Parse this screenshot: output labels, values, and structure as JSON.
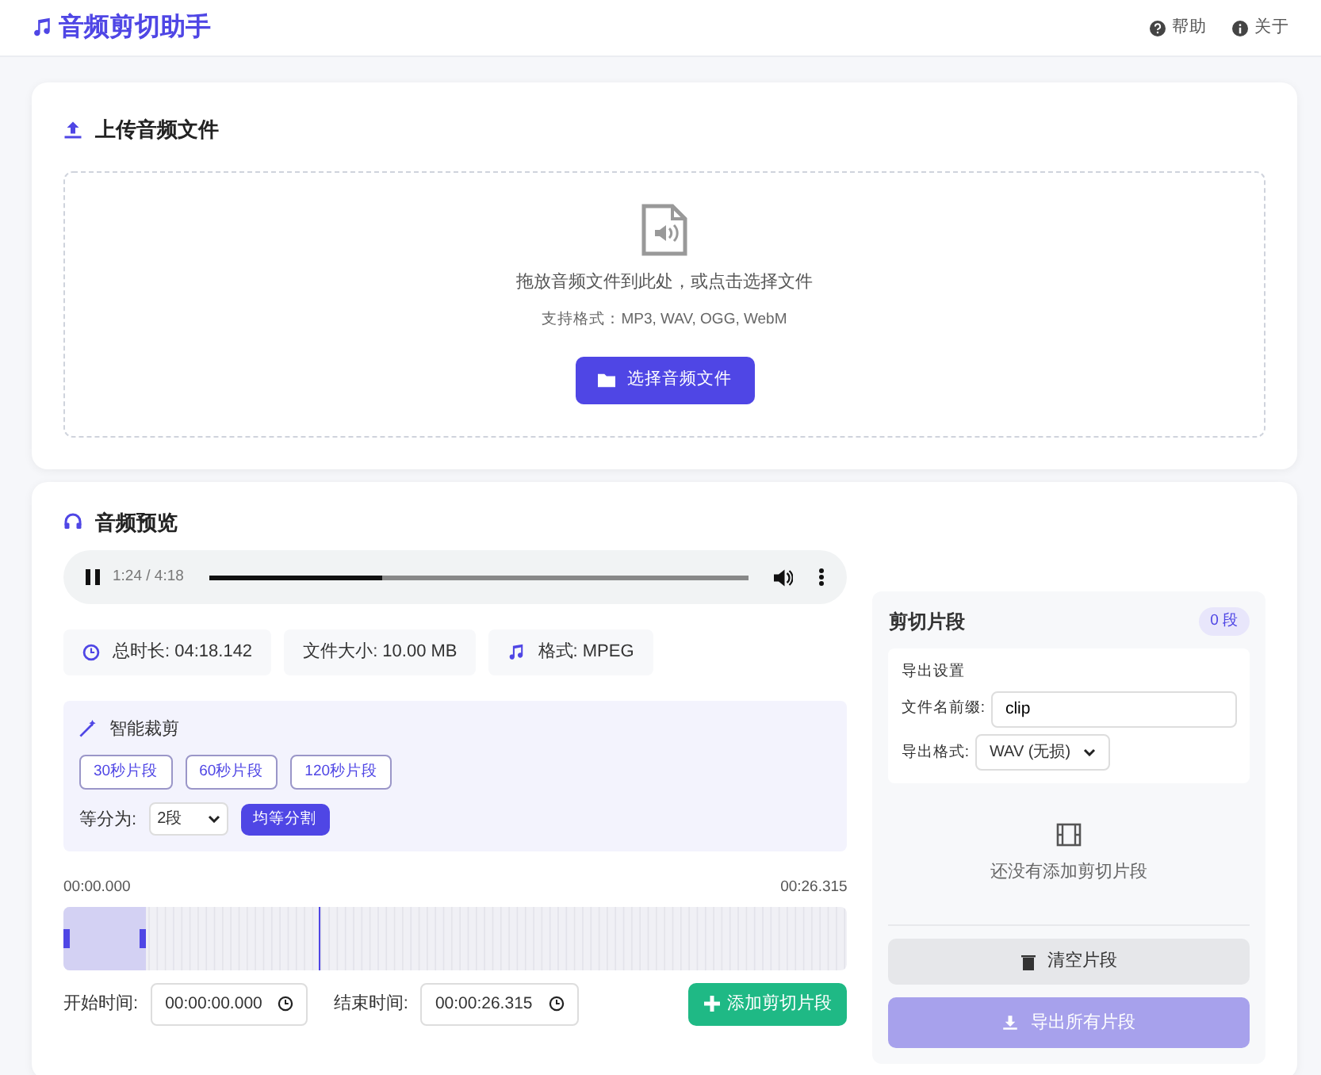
{
  "header": {
    "title": "音频剪切助手",
    "links": [
      "帮助",
      "关于"
    ]
  },
  "upload": {
    "title": "上传音频文件",
    "hint": "拖放音频文件到此处，或点击选择文件",
    "formats": "支持格式：MP3, WAV, OGG, WebM",
    "button": "选择音频文件"
  },
  "preview": {
    "title": "音频预览",
    "player": {
      "playing": true,
      "time": "1:24 / 4:18",
      "level": 0.32
    },
    "info": [
      {
        "kind": "duration",
        "text": "总时长: 04:18.142"
      },
      {
        "kind": "size",
        "text": "文件大小: 10.00 MB"
      },
      {
        "kind": "format",
        "text": "格式: MPEG"
      }
    ],
    "smart_trim": {
      "title": "智能裁剪",
      "presets": [
        "30秒片段",
        "60秒片段",
        "120秒片段"
      ],
      "split_label": "等分为:",
      "split_value": "2段",
      "split_button": "均等分割"
    },
    "timeline": {
      "start": "00:00.000",
      "end": "00:26.315",
      "selection": {
        "level": 0.105
      },
      "playhead": {
        "level": 0.325
      }
    },
    "start_label": "开始时间:",
    "start_value": "00:00:00.000",
    "end_label": "结束时间:",
    "end_value": "00:00:26.315",
    "add_button": "添加剪切片段"
  },
  "clips": {
    "title": "剪切片段",
    "count": "0 段",
    "export_settings": {
      "title": "导出设置",
      "prefix_label": "文件名前缀:",
      "prefix_value": "clip",
      "format_label": "导出格式:",
      "format_value": "WAV (无损)"
    },
    "empty_text": "还没有添加剪切片段",
    "clear_button": "清空片段",
    "export_button": {
      "label": "导出所有片段",
      "disabled": true
    }
  }
}
